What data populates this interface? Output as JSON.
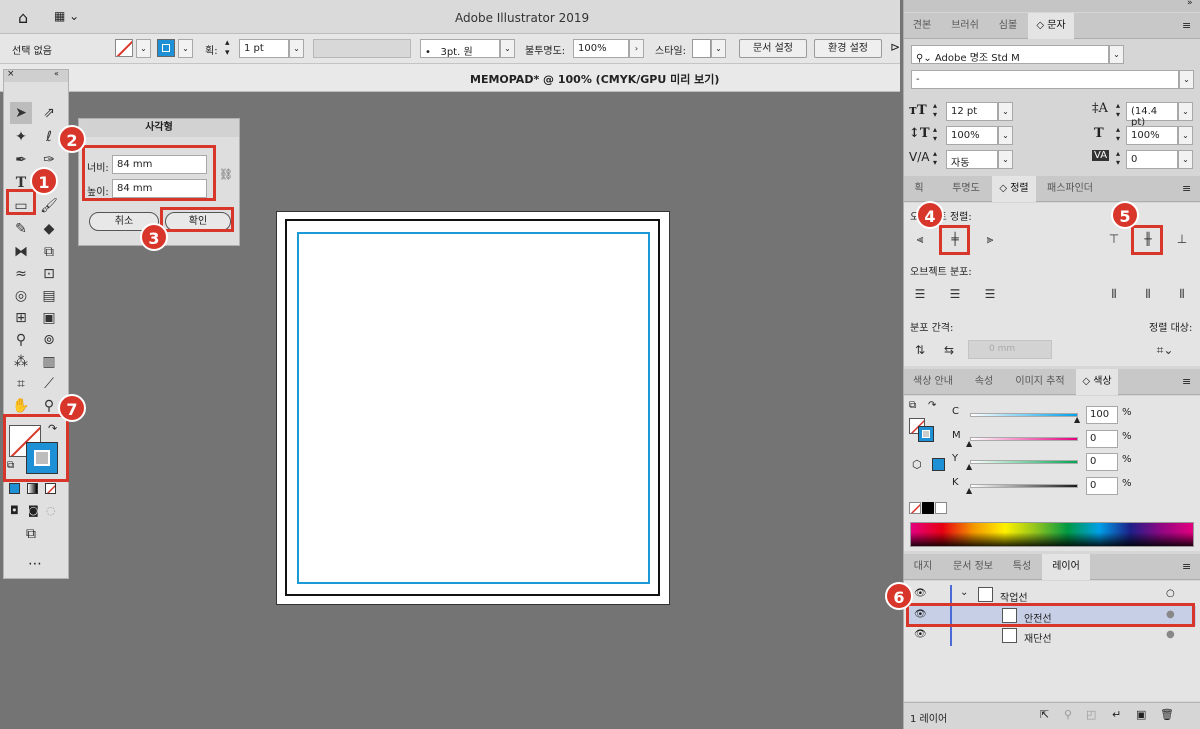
{
  "titlebar": {
    "app_title": "Adobe Illustrator 2019"
  },
  "control_bar": {
    "selection": "선택 없음",
    "stroke_label": "획:",
    "stroke_weight": "1 pt",
    "brush": "3pt. 원",
    "opacity_label": "불투명도:",
    "opacity": "100%",
    "style_label": "스타일:",
    "doc_setup": "문서 설정",
    "prefs": "환경 설정"
  },
  "document": {
    "tab_title": "MEMOPAD* @ 100% (CMYK/GPU 미리 보기)"
  },
  "dialog": {
    "title": "사각형",
    "width_label": "너비:",
    "width_value": "84 mm",
    "height_label": "높이:",
    "height_value": "84 mm",
    "cancel": "취소",
    "ok": "확인"
  },
  "character_panel": {
    "tabs": [
      "견본",
      "브러쉬",
      "심볼",
      "문자"
    ],
    "font_family": "Adobe 명조 Std M",
    "font_style": "-",
    "font_size": "12 pt",
    "leading": "(14.4 pt)",
    "vscale": "100%",
    "hscale": "100%",
    "kerning": "자동",
    "tracking": "0"
  },
  "align_panel": {
    "tabs": [
      "획",
      "투명도",
      "정렬",
      "패스파인더"
    ],
    "align_objects_label": "오브젝트 정렬:",
    "distribute_objects_label": "오브젝트 분포:",
    "distribute_spacing_label": "분포 간격:",
    "spacing_value": "0 mm",
    "align_to_label": "정렬 대상:"
  },
  "color_panel": {
    "tabs": [
      "색상 안내",
      "속성",
      "이미지 추적",
      "색상"
    ],
    "channels": [
      {
        "name": "C",
        "value": "100",
        "unit": "%",
        "level": 1.0,
        "gradient": "#00a0e9"
      },
      {
        "name": "M",
        "value": "0",
        "unit": "%",
        "level": 0.0,
        "gradient": "#e4007f"
      },
      {
        "name": "Y",
        "value": "0",
        "unit": "%",
        "level": 0.0,
        "gradient": "#00a651"
      },
      {
        "name": "K",
        "value": "0",
        "unit": "%",
        "level": 0.0,
        "gradient": "#1a1a1a"
      }
    ]
  },
  "layers_panel": {
    "tabs": [
      "대지",
      "문서 정보",
      "특성",
      "레이어"
    ],
    "layers": [
      {
        "name": "작업선",
        "level": 0
      },
      {
        "name": "안전선",
        "level": 1
      },
      {
        "name": "재단선",
        "level": 1
      }
    ],
    "footer": "1 레이어"
  },
  "badges": [
    "1",
    "2",
    "3",
    "4",
    "5",
    "6",
    "7"
  ],
  "colors": {
    "accent_red": "#d8362a",
    "guide_blue": "#1a9ad6",
    "fill_blue": "#1e90d6"
  }
}
